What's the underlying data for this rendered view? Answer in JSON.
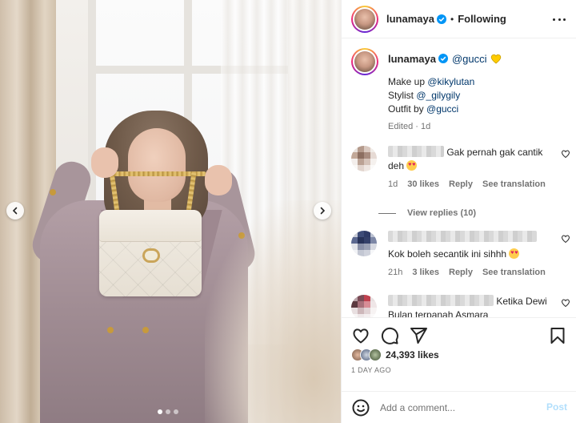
{
  "colors": {
    "link": "#00376b",
    "verified": "#0095f6",
    "heart_emoji": "#ffcc00",
    "post_disabled": "#b2dffc"
  },
  "carousel": {
    "prev_icon": "chevron-left-icon",
    "next_icon": "chevron-right-icon",
    "slide_count": 3,
    "active_slide": 1
  },
  "header": {
    "username": "lunamaya",
    "separator": "•",
    "follow_status": "Following",
    "more_icon": "more-horizontal-icon"
  },
  "caption": {
    "username": "lunamaya",
    "mention": "@gucci",
    "lines": [
      {
        "label": "Make up",
        "mention": "@kikylutan"
      },
      {
        "label": "Stylist",
        "mention": "@_gilygily"
      },
      {
        "label": "Outfit by",
        "mention": "@gucci"
      }
    ],
    "edited": "Edited",
    "time": "1d"
  },
  "comments": [
    {
      "text": "Gak pernah gak cantik deh",
      "age": "1d",
      "likes": "30 likes",
      "reply": "Reply",
      "translate": "See translation",
      "view_replies": "View replies (10)"
    },
    {
      "text": "Kok boleh secantik ini sihhh",
      "age": "21h",
      "likes": "3 likes",
      "reply": "Reply",
      "translate": "See translation"
    },
    {
      "text_line1": "Ketika Dewi",
      "text_line2": "Bulan terpanah Asmara"
    }
  ],
  "actions": {
    "like_icon": "heart-icon",
    "comment_icon": "comment-icon",
    "share_icon": "send-icon",
    "save_icon": "bookmark-icon"
  },
  "likes": {
    "count": "24,393 likes",
    "date": "1 DAY AGO"
  },
  "add_comment": {
    "placeholder": "Add a comment...",
    "post_label": "Post",
    "emoji_icon": "smiley-icon"
  }
}
